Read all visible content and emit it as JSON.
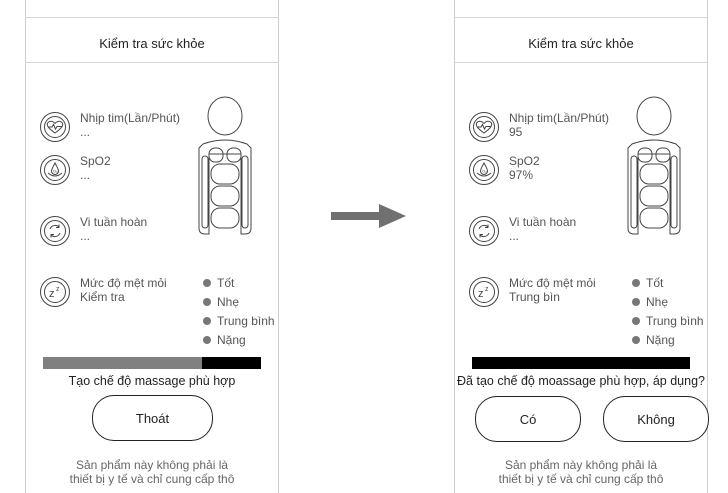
{
  "left": {
    "title": "Kiểm tra sức khỏe",
    "metrics": [
      {
        "label": "Nhịp tim(Lần/Phút)",
        "value": "...",
        "icon": "heart-rate-icon"
      },
      {
        "label": "SpO2",
        "value": "...",
        "icon": "spo2-drop-icon"
      },
      {
        "label": "Vi tuần hoàn",
        "value": "...",
        "icon": "circulation-icon"
      },
      {
        "label": "Mức độ mệt mỏi",
        "value": "Kiểm tra",
        "icon": "fatigue-zz-icon"
      }
    ],
    "legend": [
      "Tốt",
      "Nhẹ",
      "Trung bình",
      "Nặng"
    ],
    "progress": 0.73,
    "status": "Tạo chế độ massage phù hợp",
    "exit_button": "Thoát",
    "disclaimer_line1": "Sản phẩm này không phải là",
    "disclaimer_line2": "thiết bị y tế và chỉ cung cấp thô"
  },
  "right": {
    "title": "Kiểm tra sức khỏe",
    "metrics": [
      {
        "label": "Nhịp tim(Lần/Phút)",
        "value": "95",
        "icon": "heart-rate-icon"
      },
      {
        "label": "SpO2",
        "value": "97%",
        "icon": "spo2-drop-icon"
      },
      {
        "label": "Vi tuần hoàn",
        "value": "...",
        "icon": "circulation-icon"
      },
      {
        "label": "Mức độ mệt mỏi",
        "value": "Trung bìn",
        "icon": "fatigue-zz-icon"
      }
    ],
    "legend": [
      "Tốt",
      "Nhẹ",
      "Trung bình",
      "Nặng"
    ],
    "progress": 1.0,
    "status": "Đã tạo chế độ moassage phù hợp, áp dụng?",
    "yes_button": "Có",
    "no_button": "Không",
    "disclaimer_line1": "Sản phẩm này không phải là",
    "disclaimer_line2": "thiết bị y tế và chỉ cung cấp thô"
  },
  "transition_icon": "right-arrow-icon",
  "colors": {
    "progress_fill": "#808080",
    "progress_track": "#000000",
    "legend_dot": "#777777",
    "arrow": "#707070"
  }
}
